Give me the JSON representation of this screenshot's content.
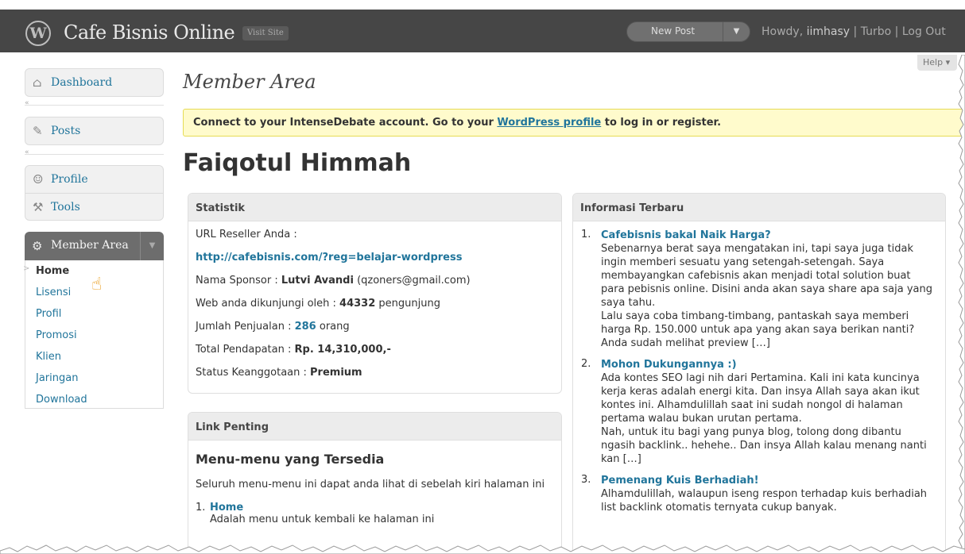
{
  "header": {
    "site_title": "Cafe Bisnis Online",
    "visit_site": "Visit Site",
    "new_post": "New Post",
    "howdy_prefix": "Howdy,",
    "username": "iimhasy",
    "turbo": "Turbo",
    "logout": "Log Out",
    "bg_color": "#464646"
  },
  "help": "Help",
  "sidebar": {
    "items": [
      {
        "label": "Dashboard",
        "icon": "house-icon"
      },
      {
        "label": "Posts",
        "icon": "pin-icon"
      },
      {
        "label": "Profile",
        "icon": "users-icon"
      },
      {
        "label": "Tools",
        "icon": "tools-icon"
      }
    ],
    "member_area": {
      "label": "Member Area",
      "items": [
        "Home",
        "Lisensi",
        "Profil",
        "Promosi",
        "Klien",
        "Jaringan",
        "Download"
      ]
    }
  },
  "main": {
    "page_title": "Member Area",
    "notice": {
      "pre": "Connect to your IntenseDebate account. Go to your ",
      "link": "WordPress profile",
      "post": " to log in or register."
    },
    "user_name": "Faiqotul Himmah",
    "statistik": {
      "title": "Statistik",
      "url_label": "URL Reseller Anda :",
      "url": "http://cafebisnis.com/?reg=belajar-wordpress",
      "sponsor_label": "Nama Sponsor : ",
      "sponsor_name": "Lutvi Avandi",
      "sponsor_email": " (qzoners@gmail.com)",
      "visits_label": "Web anda dikunjungi oleh : ",
      "visits_value": "44332",
      "visits_unit": " pengunjung",
      "sales_label": "Jumlah Penjualan : ",
      "sales_value": "286",
      "sales_unit": " orang",
      "income_label": "Total Pendapatan : ",
      "income_value": "Rp. 14,310,000,-",
      "status_label": "Status Keanggotaan : ",
      "status_value": "Premium"
    },
    "link_penting": {
      "title": "Link Penting",
      "heading": "Menu-menu yang Tersedia",
      "intro": "Seluruh menu-menu ini dapat anda lihat di sebelah kiri halaman ini",
      "items": [
        {
          "num": "1.",
          "title": "Home",
          "desc": "Adalah menu untuk kembali ke halaman ini"
        }
      ]
    },
    "informasi": {
      "title": "Informasi Terbaru",
      "items": [
        {
          "num": "1.",
          "title": "Cafebisnis bakal Naik Harga?",
          "text": "Sebenarnya berat saya mengatakan ini, tapi saya juga tidak ingin memberi sesuatu yang setengah-setengah. Saya membayangkan cafebisnis akan menjadi total solution buat para pebisnis online. Disini anda akan saya share apa saja yang saya tahu.",
          "text2": "Lalu saya coba timbang-timbang, pantaskah saya memberi harga Rp. 150.000 untuk apa yang akan saya berikan nanti? Anda sudah melihat preview […]"
        },
        {
          "num": "2.",
          "title": "Mohon Dukungannya :)",
          "text": "Ada kontes SEO lagi nih dari Pertamina. Kali ini kata kuncinya kerja keras adalah energi kita. Dan insya Allah saya akan ikut kontes ini. Alhamdulillah saat ini sudah nongol di halaman pertama walau bukan urutan pertama.",
          "text2": "Nah, untuk itu bagi yang punya blog, tolong dong dibantu ngasih backlink.. hehehe.. Dan insya Allah kalau menang nanti kan […]"
        },
        {
          "num": "3.",
          "title": "Pemenang Kuis Berhadiah!",
          "text": "Alhamdulillah, walaupun iseng respon terhadap kuis berhadiah list backlink otomatis ternyata cukup banyak.",
          "text2": ""
        }
      ]
    }
  }
}
